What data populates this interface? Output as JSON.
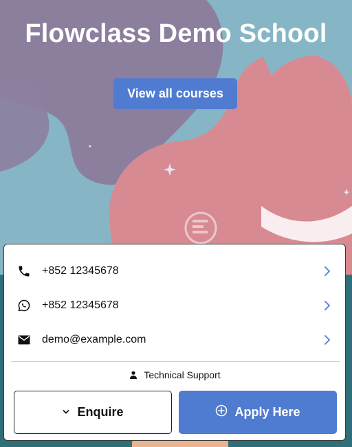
{
  "hero": {
    "title": "Flowclass Demo School",
    "view_courses_label": "View all courses"
  },
  "contacts": [
    {
      "icon": "phone-icon",
      "value": "+852 12345678"
    },
    {
      "icon": "whatsapp-icon",
      "value": "+852 12345678"
    },
    {
      "icon": "mail-icon",
      "value": "demo@example.com"
    }
  ],
  "support": {
    "icon": "user-icon",
    "label": "Technical Support"
  },
  "actions": {
    "enquire_label": "Enquire",
    "enquire_icon": "chevron-down-icon",
    "apply_label": "Apply Here",
    "apply_icon": "plus-circle-icon"
  },
  "colors": {
    "accent": "#4f7bd1",
    "hero_teal": "#86b6c6",
    "hero_purple": "#8c7f9e",
    "hero_pink": "#d88a92"
  }
}
